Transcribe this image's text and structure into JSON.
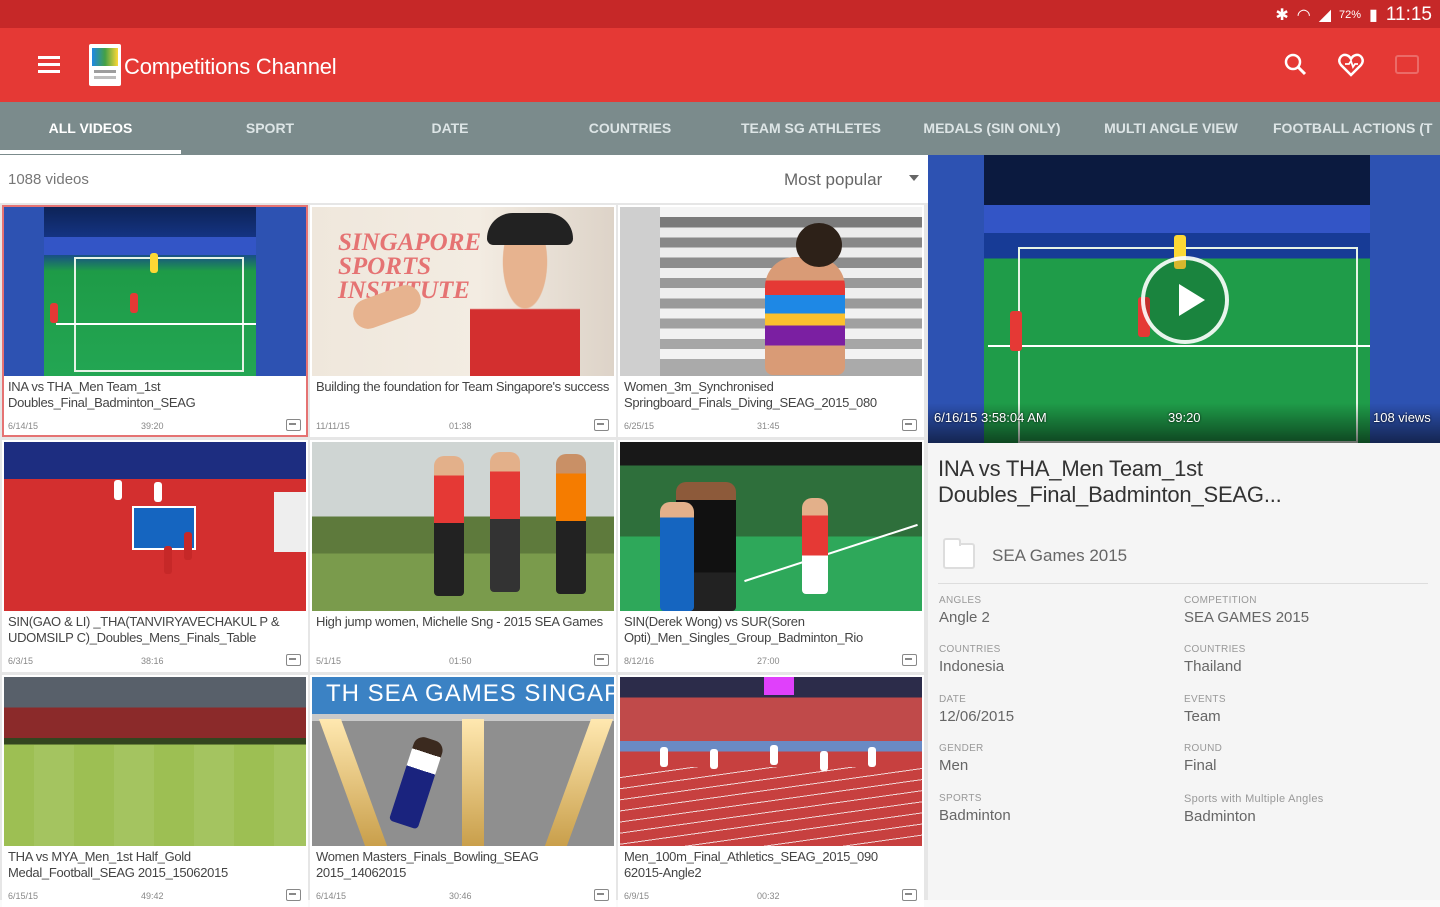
{
  "status_bar": {
    "battery": "72%",
    "time": "11:15"
  },
  "app_bar": {
    "title": "Competitions Channel"
  },
  "tabs": [
    {
      "label": "ALL VIDEOS"
    },
    {
      "label": "SPORT"
    },
    {
      "label": "DATE"
    },
    {
      "label": "COUNTRIES"
    },
    {
      "label": "TEAM SG ATHLETES"
    },
    {
      "label": "MEDALS (SIN ONLY)"
    },
    {
      "label": "MULTI ANGLE VIEW"
    },
    {
      "label": "FOOTBALL ACTIONS (T"
    }
  ],
  "list": {
    "count": "1088 videos",
    "sort": "Most popular"
  },
  "videos": [
    {
      "title": "INA vs THA_Men Team_1st Doubles_Final_Badminton_SEAG",
      "date": "6/14/15",
      "duration": "39:20"
    },
    {
      "title": "Building the foundation for Team Singapore's success",
      "date": "11/11/15",
      "duration": "01:38"
    },
    {
      "title": "Women_3m_Synchronised Springboard_Finals_Diving_SEAG_2015_080",
      "date": "6/25/15",
      "duration": "31:45"
    },
    {
      "title": "SIN(GAO & LI) _THA(TANVIRYAVECHAKUL P & UDOMSILP C)_Doubles_Mens_Finals_Table",
      "date": "6/3/15",
      "duration": "38:16"
    },
    {
      "title": "High jump women, Michelle Sng - 2015 SEA Games",
      "date": "5/1/15",
      "duration": "01:50"
    },
    {
      "title": "SIN(Derek Wong) vs SUR(Soren Opti)_Men_Singles_Group_Badminton_Rio",
      "date": "8/12/16",
      "duration": "27:00"
    },
    {
      "title": "THA vs MYA_Men_1st Half_Gold Medal_Football_SEAG 2015_15062015",
      "date": "6/15/15",
      "duration": "49:42"
    },
    {
      "title": "Women Masters_Finals_Bowling_SEAG 2015_14062015",
      "date": "6/14/15",
      "duration": "30:46"
    },
    {
      "title": "Men_100m_Final_Athletics_SEAG_2015_090 62015-Angle2",
      "date": "6/9/15",
      "duration": "00:32"
    }
  ],
  "thumb_text": {
    "institute": [
      "SINGAPORE",
      "SPORTS",
      "INSTITUTE"
    ],
    "bowling_banner": "TH SEA GAMES    SINGAP"
  },
  "preview": {
    "datetime": "6/16/15 3:58:04 AM",
    "duration": "39:20",
    "views": "108 views"
  },
  "details": {
    "title": "INA vs THA_Men Team_1st Doubles_Final_Badminton_SEAG...",
    "competition_name": "SEA Games 2015",
    "fields_left": [
      {
        "label": "ANGLES",
        "value": "Angle 2"
      },
      {
        "label": "COUNTRIES",
        "value": "Indonesia"
      },
      {
        "label": "DATE",
        "value": "12/06/2015"
      },
      {
        "label": "GENDER",
        "value": "Men"
      },
      {
        "label": "SPORTS",
        "value": "Badminton"
      }
    ],
    "fields_right": [
      {
        "label": "COMPETITION",
        "value": "SEA GAMES 2015"
      },
      {
        "label": "COUNTRIES",
        "value": "Thailand"
      },
      {
        "label": "EVENTS",
        "value": "Team"
      },
      {
        "label": "ROUND",
        "value": "Final"
      },
      {
        "label": "Sports with Multiple Angles",
        "value": "Badminton"
      }
    ]
  },
  "colors": {
    "status_bar": "#c62828",
    "app_bar": "#e53935",
    "tabs_bar": "#7b8b8c",
    "selection": "#e57373"
  },
  "icons": [
    "menu-icon",
    "search-icon",
    "favorites-icon",
    "cast-icon",
    "play-icon",
    "folder-icon",
    "caption-icon"
  ]
}
